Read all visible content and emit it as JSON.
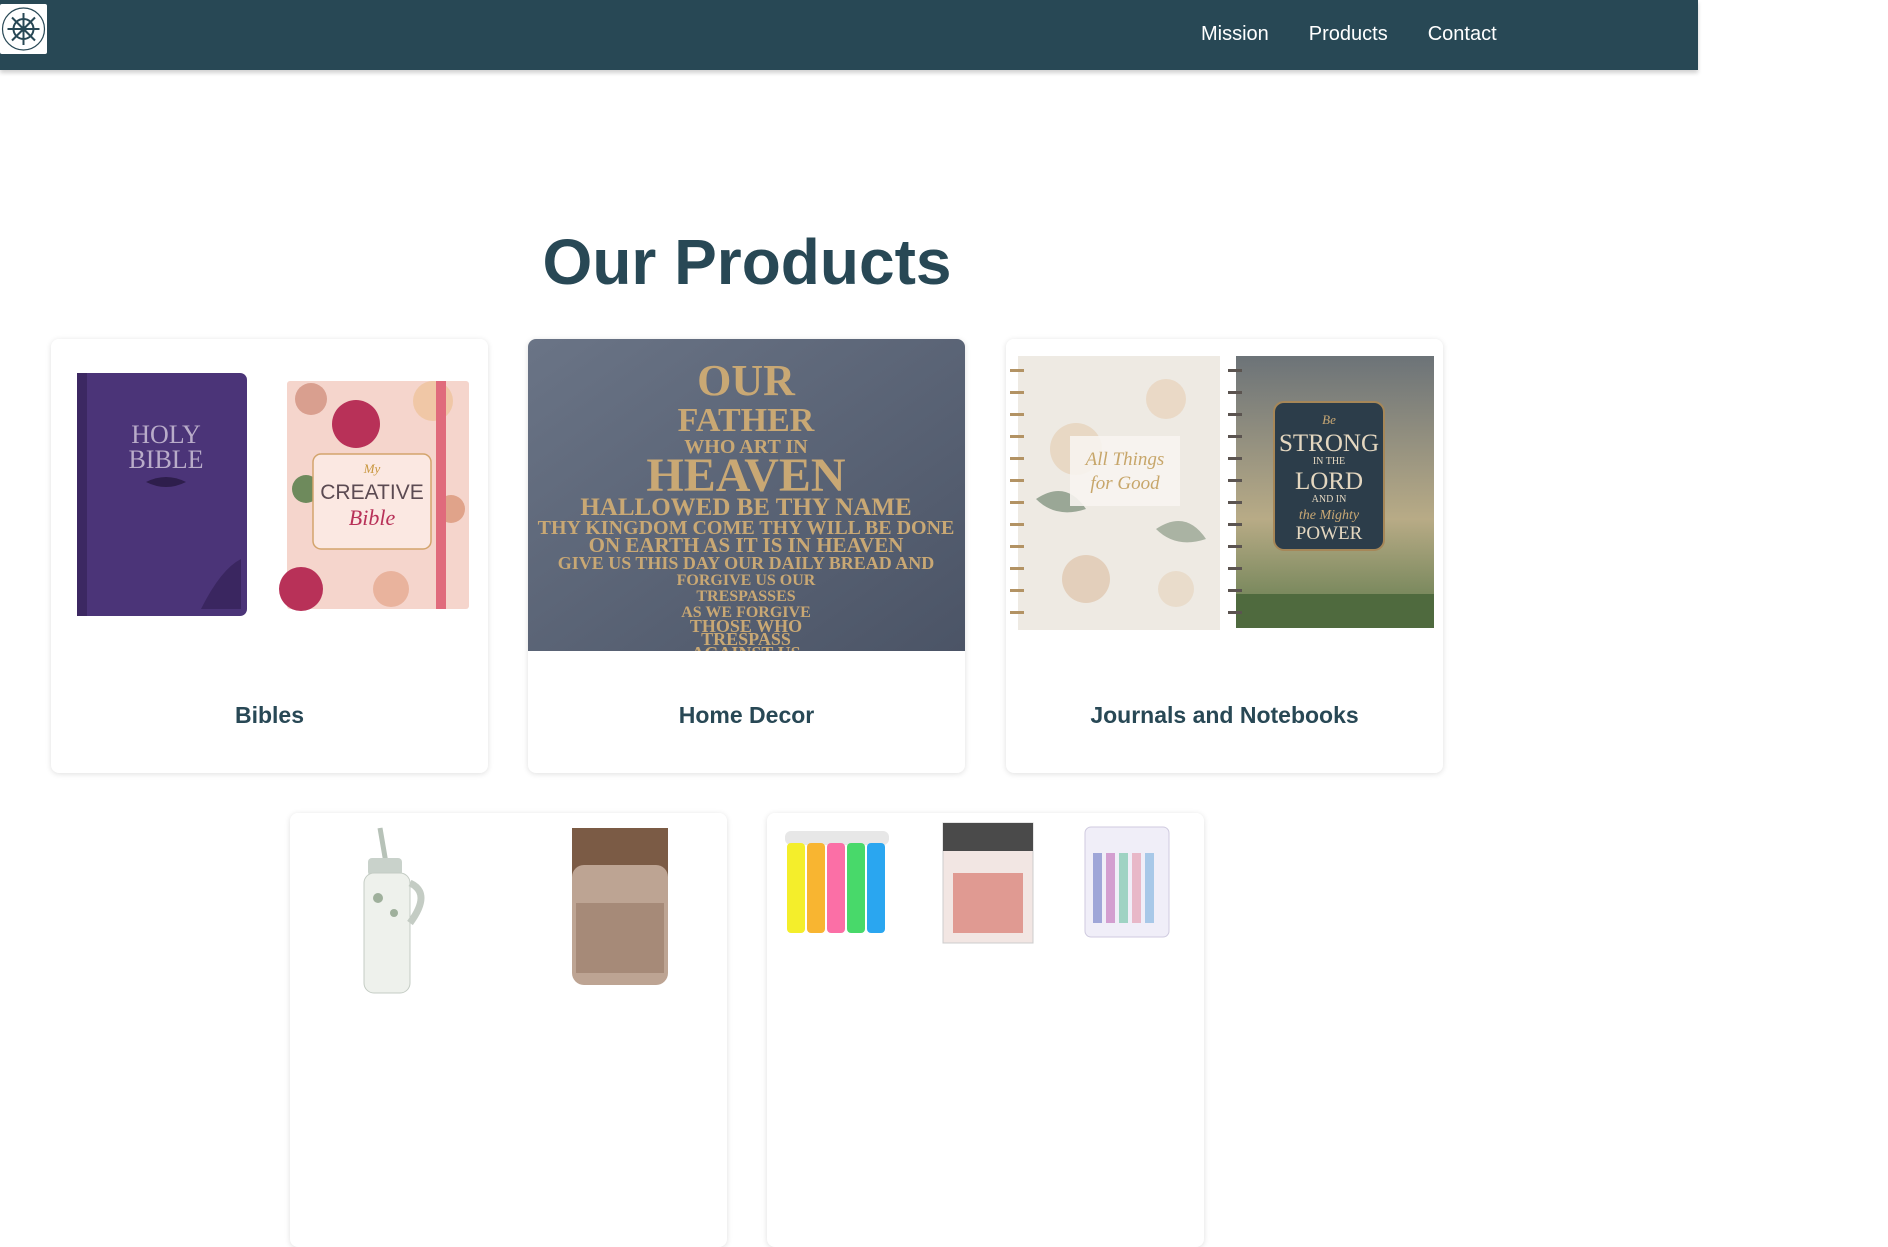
{
  "navbar": {
    "links": [
      "Mission",
      "Products",
      "Contact"
    ],
    "background": "#284855"
  },
  "main": {
    "title": "Our Products",
    "cards": [
      {
        "title": "Bibles",
        "image_text": {
          "book1": [
            "HOLY",
            "BIBLE"
          ],
          "book2": [
            "My",
            "CREATIVE",
            "Bible"
          ]
        }
      },
      {
        "title": "Home Decor",
        "image_text": {
          "cross": [
            "OUR",
            "FATHER",
            "WHO ART IN",
            "HEAVEN",
            "HALLOWED BE THY NAME",
            "THY KINGDOM COME THY WILL BE DONE",
            "ON EARTH AS IT IS IN HEAVEN",
            "GIVE US THIS DAY OUR DAILY BREAD AND",
            "FORGIVE US OUR",
            "TRESPASSES",
            "AS WE FORGIVE",
            "THOSE WHO",
            "TRESPASS",
            "AGAINST US"
          ]
        }
      },
      {
        "title": "Journals and Notebooks",
        "image_text": {
          "journal1": [
            "All Things",
            "for Good"
          ],
          "journal2": [
            "Be",
            "STRONG",
            "IN THE",
            "LORD",
            "AND IN",
            "the Mighty",
            "POWER"
          ]
        }
      },
      {
        "title": ""
      },
      {
        "title": ""
      }
    ]
  },
  "colors": {
    "primary": "#284855",
    "bible_purple": "#4b3478",
    "journal_cover": "#2c3d4a"
  },
  "icons": [
    "ship-wheel-logo-icon"
  ]
}
